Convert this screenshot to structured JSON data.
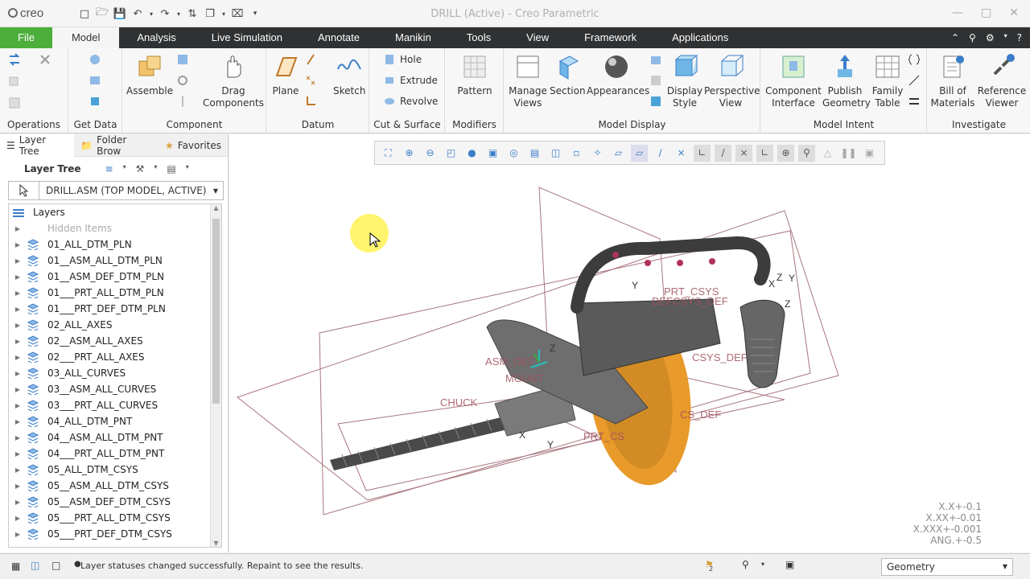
{
  "app": {
    "logo": "creo",
    "window_title": "DRILL (Active) - Creo Parametric"
  },
  "tabs": [
    "File",
    "Model",
    "Analysis",
    "Live Simulation",
    "Annotate",
    "Manikin",
    "Tools",
    "View",
    "Framework",
    "Applications"
  ],
  "active_tab": "Model",
  "ribbon": {
    "groups": {
      "operations": "Operations",
      "get_data": "Get Data",
      "component": "Component",
      "datum": "Datum",
      "cut_surface": "Cut & Surface",
      "modifiers": "Modifiers",
      "model_display": "Model Display",
      "model_intent": "Model Intent",
      "investigate": "Investigate"
    },
    "buttons": {
      "assemble": "Assemble",
      "drag_components": "Drag Components",
      "plane": "Plane",
      "sketch": "Sketch",
      "hole": "Hole",
      "extrude": "Extrude",
      "revolve": "Revolve",
      "pattern": "Pattern",
      "manage_views": "Manage Views",
      "section": "Section",
      "appearances": "Appearances",
      "display_style": "Display Style",
      "perspective_view": "Perspective View",
      "component_interface": "Component Interface",
      "publish_geometry": "Publish Geometry",
      "family_table": "Family Table",
      "bill_of_materials": "Bill of Materials",
      "reference_viewer": "Reference Viewer"
    }
  },
  "left_pane": {
    "tabs": [
      "Layer Tree",
      "Folder Brow",
      "Favorites"
    ],
    "toolbar_title": "Layer Tree",
    "model_selector": "DRILL.ASM (TOP MODEL, ACTIVE)",
    "root": "Layers",
    "hidden_items": "Hidden Items",
    "layers": [
      "01_ALL_DTM_PLN",
      "01__ASM_ALL_DTM_PLN",
      "01__ASM_DEF_DTM_PLN",
      "01___PRT_ALL_DTM_PLN",
      "01___PRT_DEF_DTM_PLN",
      "02_ALL_AXES",
      "02__ASM_ALL_AXES",
      "02___PRT_ALL_AXES",
      "03_ALL_CURVES",
      "03__ASM_ALL_CURVES",
      "03___PRT_ALL_CURVES",
      "04_ALL_DTM_PNT",
      "04__ASM_ALL_DTM_PNT",
      "04___PRT_ALL_DTM_PNT",
      "05_ALL_DTM_CSYS",
      "05__ASM_ALL_DTM_CSYS",
      "05__ASM_DEF_DTM_CSYS",
      "05___PRT_ALL_DTM_CSYS",
      "05___PRT_DEF_DTM_CSYS"
    ]
  },
  "viewport": {
    "tolerances": [
      "X.X+-0.1",
      "X.XX+-0.01",
      "X.XXX+-0.001",
      "ANG.+-0.5"
    ]
  },
  "status": {
    "message": "Layer statuses changed successfully. Repaint to see the results.",
    "flag_count": "2",
    "filter": "Geometry"
  }
}
